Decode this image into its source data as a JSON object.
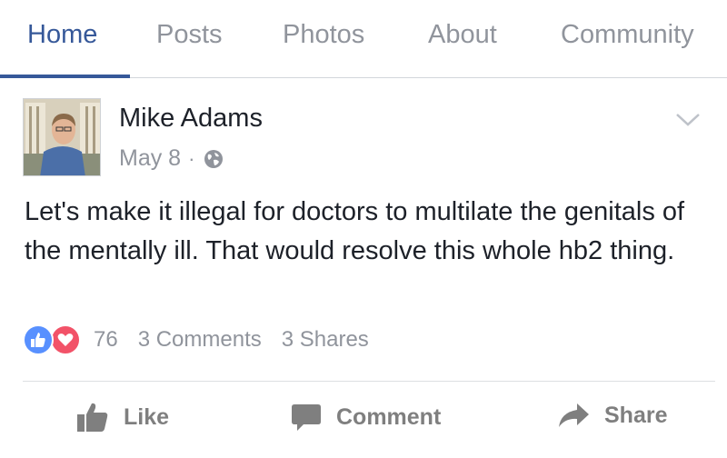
{
  "tabs": [
    {
      "label": "Home",
      "active": true
    },
    {
      "label": "Posts",
      "active": false
    },
    {
      "label": "Photos",
      "active": false
    },
    {
      "label": "About",
      "active": false
    },
    {
      "label": "Community",
      "active": false
    }
  ],
  "post": {
    "author": "Mike Adams",
    "date": "May 8",
    "separator": "·",
    "privacy_icon": "globe-icon",
    "options_icon": "chevron-down-icon",
    "text": "Let's make it illegal for doctors to multilate the genitals of the mentally ill. That would resolve this whole hb2 thing.",
    "reaction_icons": [
      "like-reaction-icon",
      "love-reaction-icon"
    ],
    "reactions_count": "76",
    "comments_label": "3 Comments",
    "shares_label": "3 Shares"
  },
  "actions": {
    "like": "Like",
    "comment": "Comment",
    "share": "Share"
  },
  "colors": {
    "active_tab": "#365899",
    "inactive_tab": "#90949c",
    "like_blue": "#5890ff",
    "love_red": "#f25268",
    "action_gray": "#7f7f7f"
  }
}
